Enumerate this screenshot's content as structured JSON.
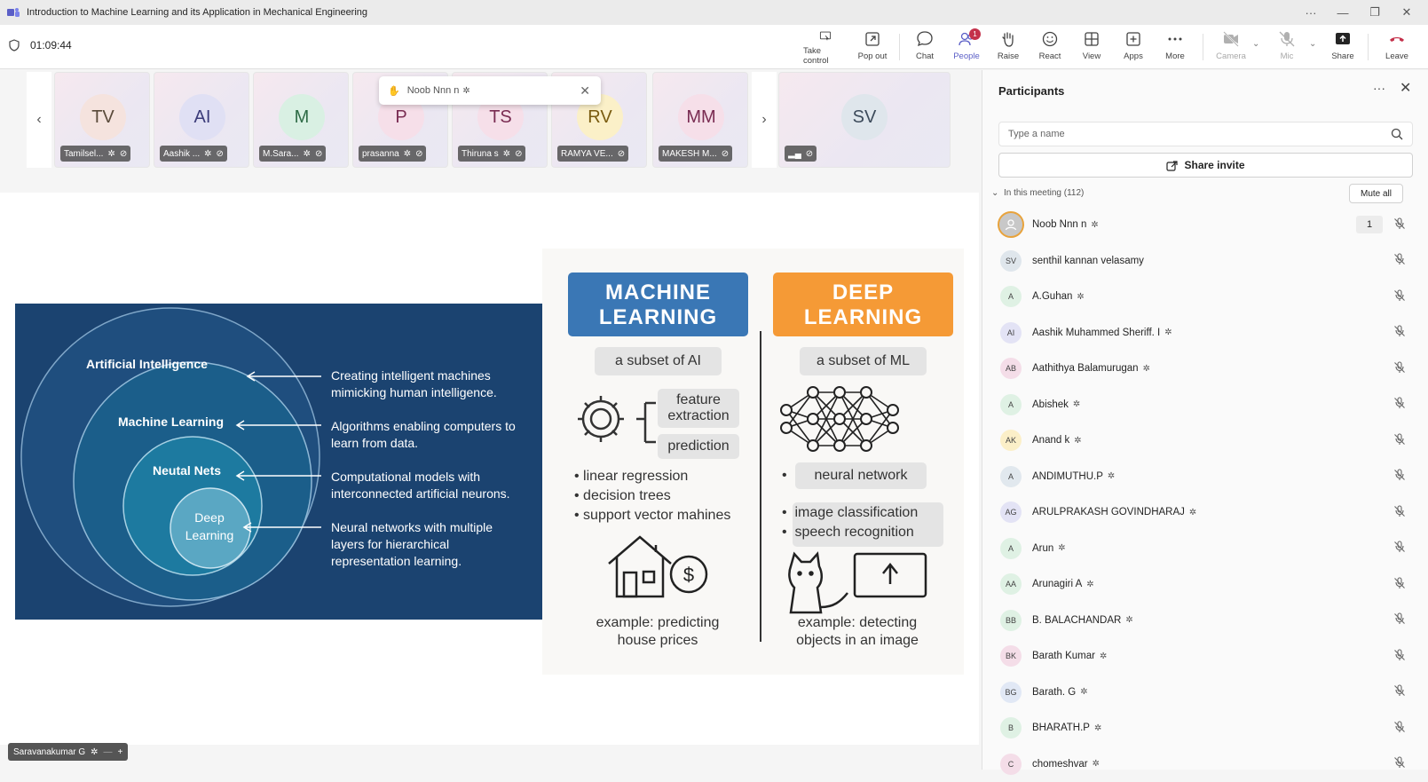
{
  "window": {
    "title": "Introduction to Machine Learning and its Application in Mechanical Engineering"
  },
  "toolbar": {
    "timer": "01:09:44",
    "buttons": [
      {
        "label": "Take control",
        "icon": "take-control-icon"
      },
      {
        "label": "Pop out",
        "icon": "pop-out-icon"
      },
      {
        "label": "Chat",
        "icon": "chat-icon"
      },
      {
        "label": "People",
        "icon": "people-icon",
        "badge": "1"
      },
      {
        "label": "Raise",
        "icon": "raise-hand-icon"
      },
      {
        "label": "React",
        "icon": "react-icon"
      },
      {
        "label": "View",
        "icon": "view-icon"
      },
      {
        "label": "Apps",
        "icon": "apps-icon"
      },
      {
        "label": "More",
        "icon": "more-icon"
      },
      {
        "label": "Camera",
        "icon": "camera-off-icon"
      },
      {
        "label": "Mic",
        "icon": "mic-off-icon"
      },
      {
        "label": "Share",
        "icon": "share-icon"
      },
      {
        "label": "Leave",
        "icon": "leave-icon"
      }
    ]
  },
  "strip": {
    "tiles": [
      {
        "initials": "TV",
        "name": "Tamilsel...",
        "color": "#f5e3de",
        "text": "#5a4a3a"
      },
      {
        "initials": "AI",
        "name": "Aashik ...",
        "color": "#e0e0f4",
        "text": "#3c3c7a"
      },
      {
        "initials": "M",
        "name": "M.Sara...",
        "color": "#d9f0e3",
        "text": "#2e6b46"
      },
      {
        "initials": "P",
        "name": "prasanna",
        "color": "#f6dfe9",
        "text": "#7a2c52"
      },
      {
        "initials": "TS",
        "name": "Thiruna s",
        "color": "#f6dfe9",
        "text": "#7a2c52"
      },
      {
        "initials": "RV",
        "name": "RAMYA VE...",
        "color": "#fbf0c8",
        "text": "#7a5c10"
      },
      {
        "initials": "MM",
        "name": "MAKESH M...",
        "color": "#f6dfe9",
        "text": "#7a2c52"
      }
    ],
    "self_tile": {
      "initials": "SV",
      "color": "#dfe6ec",
      "text": "#3c4a5a"
    },
    "toast": {
      "name": "Noob Nnn n"
    }
  },
  "slide": {
    "ai_layers": [
      {
        "label": "Artificial Intelligence",
        "desc": [
          "Creating intelligent machines",
          "mimicking human intelligence."
        ]
      },
      {
        "label": "Machine Learning",
        "desc": [
          "Algorithms enabling computers to",
          "learn from data."
        ]
      },
      {
        "label": "Neutal Nets",
        "desc": [
          "Computational models with",
          "interconnected artificial neurons."
        ]
      },
      {
        "label_lines": [
          "Deep",
          "Learning"
        ],
        "desc": [
          "Neural networks with multiple",
          "layers for hierarchical",
          "representation learning."
        ]
      }
    ],
    "ml": {
      "title_lines": [
        "MACHINE",
        "LEARNING"
      ],
      "subset": "a subset of AI",
      "box1": [
        "feature",
        "extraction"
      ],
      "box2": "prediction",
      "bullets": [
        "linear regression",
        "decision trees",
        "support vector mahines"
      ],
      "example": [
        "example: predicting",
        "house prices"
      ],
      "color": "#3a77b5"
    },
    "dl": {
      "title_lines": [
        "DEEP",
        "LEARNING"
      ],
      "subset": "a subset of ML",
      "bullet_boxed": "neural network",
      "bullets": [
        "image classification",
        "speech recognition"
      ],
      "example": [
        "example: detecting",
        "objects in an image"
      ],
      "color": "#f59a36"
    }
  },
  "presenter": {
    "name": "Saravanakumar G"
  },
  "participants": {
    "title": "Participants",
    "search_placeholder": "Type a name",
    "share_invite": "Share invite",
    "in_meeting": "In this meeting (112)",
    "mute_all": "Mute all",
    "list": [
      {
        "initials": "",
        "name": "Noob Nnn n",
        "raised": "1",
        "me": true
      },
      {
        "initials": "SV",
        "name": "senthil kannan velasamy",
        "color": "#dfe6ec"
      },
      {
        "initials": "A",
        "name": "A.Guhan",
        "color": "#dff1e4"
      },
      {
        "initials": "AI",
        "name": "Aashik Muhammed Sheriff. I",
        "color": "#e3e3f5"
      },
      {
        "initials": "AB",
        "name": "Aathithya Balamurugan",
        "color": "#f4dde8"
      },
      {
        "initials": "A",
        "name": "Abishek",
        "color": "#dff1e4"
      },
      {
        "initials": "AK",
        "name": "Anand k",
        "color": "#fbefc8"
      },
      {
        "initials": "A",
        "name": "ANDIMUTHU.P",
        "color": "#e1e8ee"
      },
      {
        "initials": "AG",
        "name": "ARULPRAKASH GOVINDHARAJ",
        "color": "#e3e3f5"
      },
      {
        "initials": "A",
        "name": "Arun",
        "color": "#dff1e4"
      },
      {
        "initials": "AA",
        "name": "Arunagiri A",
        "color": "#dff1e4"
      },
      {
        "initials": "BB",
        "name": "B. BALACHANDAR",
        "color": "#dff1e4"
      },
      {
        "initials": "BK",
        "name": "Barath Kumar",
        "color": "#f4dde8"
      },
      {
        "initials": "BG",
        "name": "Barath. G",
        "color": "#e1e8f5"
      },
      {
        "initials": "B",
        "name": "BHARATH.P",
        "color": "#dff1e4"
      },
      {
        "initials": "C",
        "name": "chomeshvar",
        "color": "#f4dde8"
      }
    ]
  }
}
